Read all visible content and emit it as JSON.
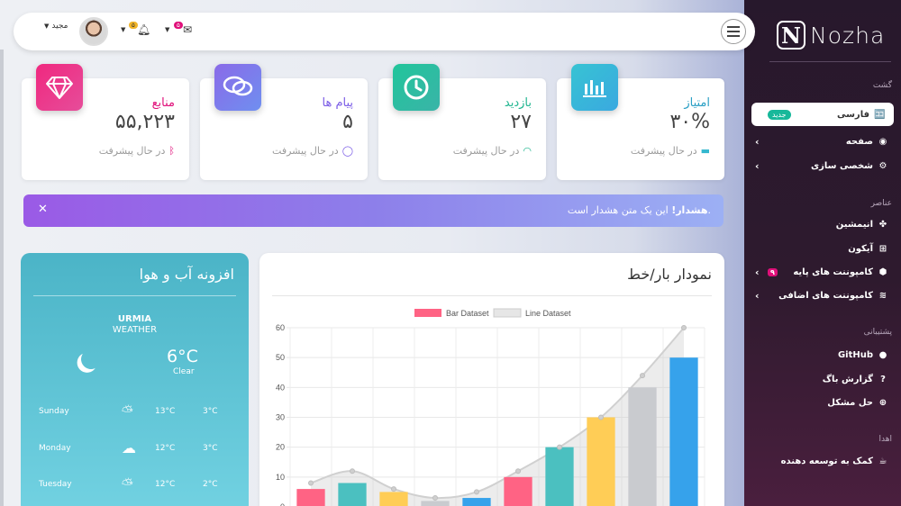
{
  "brand": {
    "name": "Nozha",
    "mark": "N"
  },
  "sidebar": {
    "section_nav": "گشت",
    "section_elements": "عناصر",
    "section_support": "پشتیبانی",
    "section_donate": "اهدا",
    "items": [
      {
        "label": "فارسی",
        "icon": "language-icon",
        "badge": "جدید"
      },
      {
        "label": "صفحه",
        "icon": "dashboard-icon"
      },
      {
        "label": "شخصی سازی",
        "icon": "gear-icon"
      },
      {
        "label": "انیمشین",
        "icon": "fan-icon"
      },
      {
        "label": "آیکون",
        "icon": "icons-grid-icon"
      },
      {
        "label": "کامپوننت های پایه",
        "icon": "cube-icon",
        "badge": "۹"
      },
      {
        "label": "کامپوننت های اضافی",
        "icon": "layers-icon"
      },
      {
        "label": "GitHub",
        "icon": "github-icon"
      },
      {
        "label": "گزارش باگ",
        "icon": "question-icon"
      },
      {
        "label": "حل مشکل",
        "icon": "lifebuoy-icon"
      },
      {
        "label": "کمک به توسعه دهنده",
        "icon": "coffee-icon"
      }
    ]
  },
  "navbar": {
    "user_name": "مجید",
    "notif_badge": "۵",
    "mail_badge": "۵"
  },
  "cards": [
    {
      "title": "امتیاز",
      "value": "۳۰%",
      "foot": "در حال پیشرفت",
      "icon": "chart-bars-icon",
      "color": "#35b8cf"
    },
    {
      "title": "بازدید",
      "value": "۲۷",
      "foot": "در حال پیشرفت",
      "icon": "clock-icon",
      "color": "#1fb58f"
    },
    {
      "title": "پیام ها",
      "value": "۵",
      "foot": "در حال پیشرفت",
      "icon": "chat-icon",
      "color": "#7a5ce6"
    },
    {
      "title": "منابع",
      "value": "۵۵,۲۲۳",
      "foot": "در حال پیشرفت",
      "icon": "diamond-icon",
      "color": "#e0107a"
    }
  ],
  "alert": {
    "strong": "هشدار!",
    "text": "این یک متن هشدار است."
  },
  "weather": {
    "title": "افزونه آب و هوا",
    "city": "URMIA",
    "subtitle": "WEATHER",
    "temp": "6°C",
    "condition": "Clear",
    "forecast": [
      {
        "day": "Sunday",
        "hi": "13°C",
        "lo": "3°C"
      },
      {
        "day": "Monday",
        "hi": "12°C",
        "lo": "3°C"
      },
      {
        "day": "Tuesday",
        "hi": "12°C",
        "lo": "2°C"
      }
    ]
  },
  "chart": {
    "title": "نمودار بار/خط"
  },
  "chart_data": {
    "type": "bar",
    "title": "",
    "categories": [
      "",
      "",
      "",
      "",
      "",
      "",
      "",
      "",
      "",
      ""
    ],
    "ylim": [
      0,
      60
    ],
    "yticks": [
      0,
      10,
      20,
      30,
      40,
      50,
      60
    ],
    "grid": true,
    "legend": "top",
    "series": [
      {
        "name": "Bar Dataset",
        "type": "bar",
        "values": [
          6,
          8,
          5,
          2,
          3,
          10,
          20,
          30,
          40,
          50
        ],
        "colors": [
          "#ff6384",
          "#4bc0c0",
          "#ffcd56",
          "#c9cbcf",
          "#36a2eb",
          "#ff6384",
          "#4bc0c0",
          "#ffcd56",
          "#c9cbcf",
          "#36a2eb"
        ]
      },
      {
        "name": "Line Dataset",
        "type": "line",
        "values": [
          8,
          12,
          6,
          3,
          5,
          12,
          20,
          30,
          44,
          60
        ],
        "color": "#d6d6d6"
      }
    ]
  }
}
